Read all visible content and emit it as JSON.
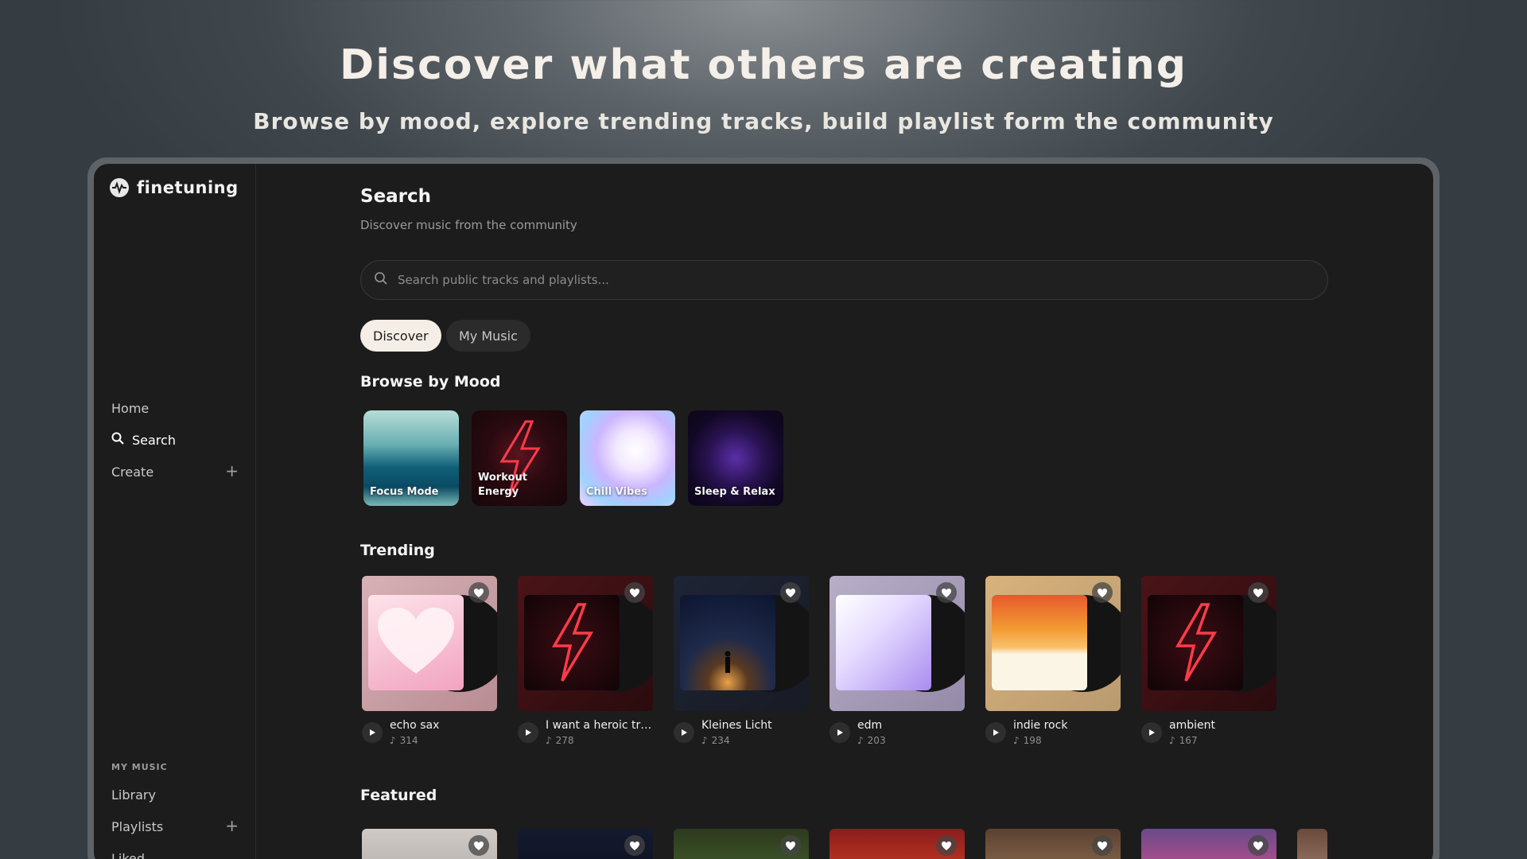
{
  "hero": {
    "title": "Discover what others are creating",
    "subtitle": "Browse by mood, explore trending tracks, build playlist form the community"
  },
  "brand": {
    "name": "finetuning"
  },
  "sidebar": {
    "nav": [
      {
        "label": "Home"
      },
      {
        "label": "Search"
      },
      {
        "label": "Create"
      }
    ],
    "section_label": "MY MUSIC",
    "my_music": [
      {
        "label": "Library"
      },
      {
        "label": "Playlists"
      },
      {
        "label": "Liked"
      }
    ]
  },
  "page": {
    "title": "Search",
    "subtitle": "Discover music from the community"
  },
  "search": {
    "placeholder": "Search public tracks and playlists..."
  },
  "tabs": [
    {
      "label": "Discover",
      "active": true
    },
    {
      "label": "My Music",
      "active": false
    }
  ],
  "moods": {
    "heading": "Browse by Mood",
    "items": [
      {
        "label": "Focus Mode"
      },
      {
        "label": "Workout Energy"
      },
      {
        "label": "Chill Vibes"
      },
      {
        "label": "Sleep & Relax"
      }
    ]
  },
  "trending": {
    "heading": "Trending",
    "tracks": [
      {
        "title": "echo sax",
        "count": "314"
      },
      {
        "title": "I want a heroic tra...",
        "count": "278"
      },
      {
        "title": "Kleines Licht",
        "count": "234"
      },
      {
        "title": "edm",
        "count": "203"
      },
      {
        "title": "indie rock",
        "count": "198"
      },
      {
        "title": "ambient",
        "count": "167"
      }
    ]
  },
  "featured": {
    "heading": "Featured"
  },
  "colors": {
    "background": "#1c1c1c",
    "accent_tab": "#f4eee6",
    "neon": "#ff3344"
  }
}
